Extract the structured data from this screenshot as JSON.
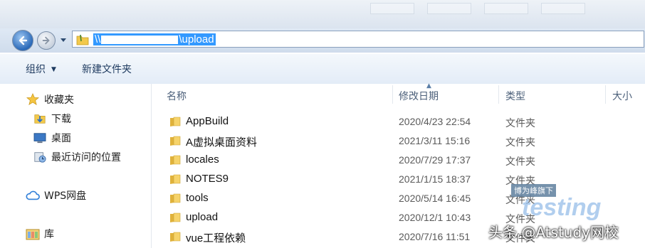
{
  "window": {
    "address": {
      "prefix": "\\\\",
      "suffix": "\\upload"
    }
  },
  "toolbar": {
    "organize_label": "组织",
    "new_folder_label": "新建文件夹"
  },
  "nav_pane": {
    "favorites_label": "收藏夹",
    "downloads_label": "下载",
    "desktop_label": "桌面",
    "recent_label": "最近访问的位置",
    "wps_label": "WPS网盘",
    "library_label": "库"
  },
  "columns": {
    "name": "名称",
    "modified": "修改日期",
    "type": "类型",
    "size": "大小"
  },
  "files": [
    {
      "name": "AppBuild",
      "date": "2020/4/23 22:54",
      "type": "文件夹"
    },
    {
      "name": "A虚拟桌面资料",
      "date": "2021/3/11 15:16",
      "type": "文件夹"
    },
    {
      "name": "locales",
      "date": "2020/7/29 17:37",
      "type": "文件夹"
    },
    {
      "name": "NOTES9",
      "date": "2021/1/15 18:37",
      "type": "文件夹"
    },
    {
      "name": "tools",
      "date": "2020/5/14 16:45",
      "type": "文件夹"
    },
    {
      "name": "upload",
      "date": "2020/12/1 10:43",
      "type": "文件夹"
    },
    {
      "name": "vue工程依赖",
      "date": "2020/7/16 11:51",
      "type": "文件夹"
    }
  ],
  "overlay": {
    "brand_tag": "博为峰旗下",
    "brand_word": "testing",
    "credit": "头条 @Atstudy网校"
  },
  "colors": {
    "selection": "#3399ff",
    "folder": "#f2c94c",
    "nav_gradient_top": "#dfe9f5"
  }
}
